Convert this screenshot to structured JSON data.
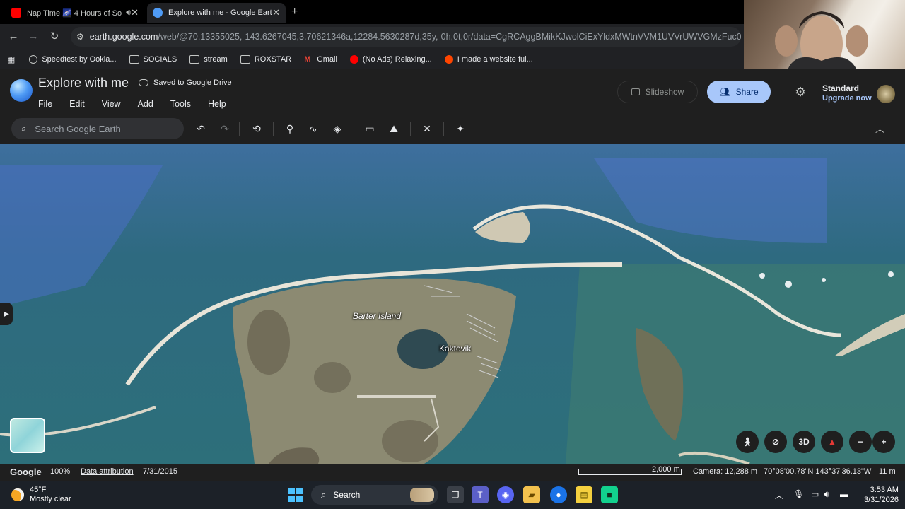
{
  "browser": {
    "tabs": [
      {
        "title": "Nap Time 🌌 4 Hours of So",
        "favicon_color": "#ff0000"
      },
      {
        "title": "Explore with me - Google Earth",
        "favicon_color": "#4f9bf5"
      }
    ],
    "url_host": "earth.google.com",
    "url_path": "/web/@70.13355025,-143.6267045,3.70621346a,12284.5630287d,35y,-0h,0t,0r/data=CgRCAggBMikKJwolCiExYldxMWtnVVM1UVVrUWVGMzFuc0VYcHZzWGJ...",
    "bookmarks": [
      {
        "label": "Speedtest by Ookla...",
        "icon": "speedtest-icon"
      },
      {
        "label": "SOCIALS",
        "icon": "folder-icon"
      },
      {
        "label": "stream",
        "icon": "folder-icon"
      },
      {
        "label": "ROXSTAR",
        "icon": "folder-icon"
      },
      {
        "label": "Gmail",
        "icon": "gmail-icon"
      },
      {
        "label": "(No Ads) Relaxing...",
        "icon": "youtube-icon"
      },
      {
        "label": "I made a website ful...",
        "icon": "reddit-icon"
      }
    ]
  },
  "earth": {
    "doc_title": "Explore with me",
    "saved_status": "Saved to Google Drive",
    "menu": [
      "File",
      "Edit",
      "View",
      "Add",
      "Tools",
      "Help"
    ],
    "slideshow_label": "Slideshow",
    "share_label": "Share",
    "plan_name": "Standard",
    "upgrade_label": "Upgrade now",
    "search_placeholder": "Search Google Earth",
    "map_labels": {
      "barter_island": "Barter Island",
      "kaktovik": "Kaktovik"
    },
    "btn_3d": "3D",
    "status": {
      "google": "Google",
      "zoom": "100%",
      "data_attribution": "Data attribution",
      "imagery_date": "7/31/2015",
      "scale": "2,000 m",
      "camera": "Camera: 12,288 m",
      "coords": "70°08'00.78\"N 143°37'36.13\"W",
      "elevation": "11 m"
    }
  },
  "taskbar": {
    "temp": "45°F",
    "condition": "Mostly clear",
    "search_label": "Search",
    "time": "3:53 AM",
    "date": "3/31/2026"
  },
  "colors": {
    "accent": "#a8c7fa",
    "share_text": "#062e6f",
    "water": "#2f6d80",
    "land": "#8c8a72"
  }
}
